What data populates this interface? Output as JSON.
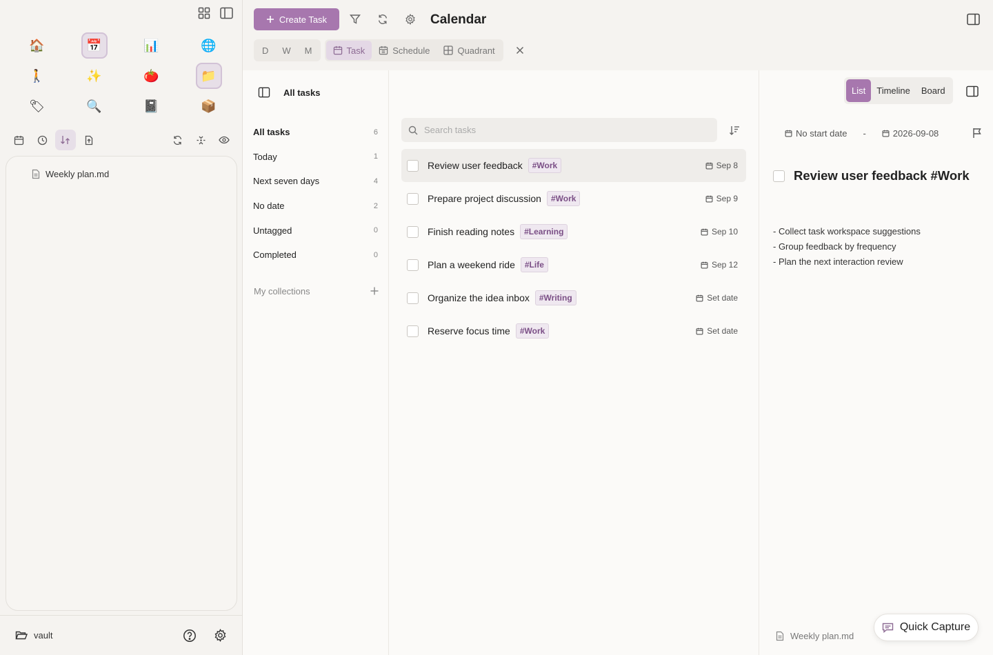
{
  "sidebar": {
    "apps": [
      {
        "name": "home-app",
        "glyph": "🏠",
        "selected": false
      },
      {
        "name": "calendar-app",
        "glyph": "📅",
        "selected": true
      },
      {
        "name": "chart-app",
        "glyph": "📊",
        "selected": false
      },
      {
        "name": "globe-app",
        "glyph": "🌐",
        "selected": false
      },
      {
        "name": "walk-app",
        "glyph": "🚶",
        "selected": false
      },
      {
        "name": "sparkles-app",
        "glyph": "✨",
        "selected": false
      },
      {
        "name": "tomato-app",
        "glyph": "🍅",
        "selected": false
      },
      {
        "name": "folder-app",
        "glyph": "📁",
        "selected": true
      },
      {
        "name": "tag-app",
        "glyph": "🏷",
        "selected": false
      },
      {
        "name": "search-app",
        "glyph": "🔍",
        "selected": false
      },
      {
        "name": "notebook-app",
        "glyph": "📓",
        "selected": false
      },
      {
        "name": "box-app",
        "glyph": "📦",
        "selected": false
      }
    ],
    "file": "Weekly plan.md",
    "vault": "vault"
  },
  "header": {
    "create_label": "Create Task",
    "title": "Calendar",
    "period_tabs": [
      "D",
      "W",
      "M"
    ],
    "view_tabs": [
      {
        "label": "Task",
        "active": true
      },
      {
        "label": "Schedule",
        "active": false
      },
      {
        "label": "Quadrant",
        "active": false
      }
    ]
  },
  "filters": {
    "title": "All tasks",
    "items": [
      {
        "label": "All tasks",
        "count": "6",
        "active": true
      },
      {
        "label": "Today",
        "count": "1",
        "active": false
      },
      {
        "label": "Next seven days",
        "count": "4",
        "active": false
      },
      {
        "label": "No date",
        "count": "2",
        "active": false
      },
      {
        "label": "Untagged",
        "count": "0",
        "active": false
      },
      {
        "label": "Completed",
        "count": "0",
        "active": false
      }
    ],
    "collections_label": "My collections"
  },
  "tasks": {
    "search_placeholder": "Search tasks",
    "items": [
      {
        "title": "Review user feedback",
        "tag": "#Work",
        "date": "Sep 8",
        "selected": true
      },
      {
        "title": "Prepare project discussion",
        "tag": "#Work",
        "date": "Sep 9",
        "selected": false
      },
      {
        "title": "Finish reading notes",
        "tag": "#Learning",
        "date": "Sep 10",
        "selected": false
      },
      {
        "title": "Plan a weekend ride",
        "tag": "#Life",
        "date": "Sep 12",
        "selected": false
      },
      {
        "title": "Organize the idea inbox",
        "tag": "#Writing",
        "date": "Set date",
        "selected": false
      },
      {
        "title": "Reserve focus time",
        "tag": "#Work",
        "date": "Set date",
        "selected": false
      }
    ]
  },
  "detail": {
    "view_tabs": [
      {
        "label": "List",
        "active": true
      },
      {
        "label": "Timeline",
        "active": false
      },
      {
        "label": "Board",
        "active": false
      }
    ],
    "start_date": "No start date",
    "separator": "-",
    "due_date": "2026-09-08",
    "title": "Review user feedback #Work",
    "notes": [
      "- Collect task workspace suggestions",
      "- Group feedback by frequency",
      "- Plan the next interaction review"
    ],
    "file": "Weekly plan.md",
    "quick_capture": "Quick Capture"
  },
  "colors": {
    "accent": "#a777ae",
    "accent_soft": "#e7dfe8",
    "tag_text": "#7b4f86"
  }
}
